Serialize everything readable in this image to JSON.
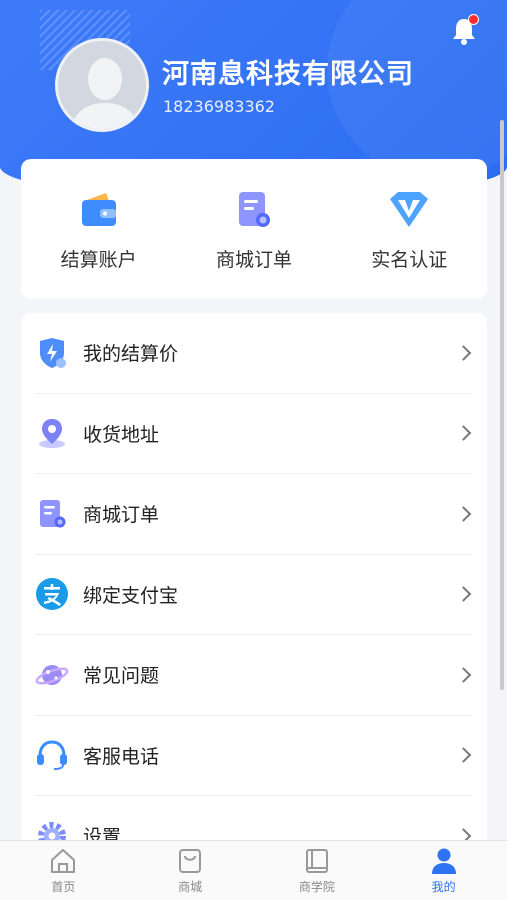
{
  "profile": {
    "company": "河南息科技有限公司",
    "phone": "18236983362"
  },
  "quick_actions": [
    {
      "label": "结算账户",
      "icon": "wallet-icon"
    },
    {
      "label": "商城订单",
      "icon": "order-icon"
    },
    {
      "label": "实名认证",
      "icon": "verify-diamond-icon"
    }
  ],
  "menu": [
    {
      "label": "我的结算价",
      "icon": "settlement-shield-icon"
    },
    {
      "label": "收货地址",
      "icon": "location-pin-icon"
    },
    {
      "label": "商城订单",
      "icon": "order-icon"
    },
    {
      "label": "绑定支付宝",
      "icon": "alipay-icon"
    },
    {
      "label": "常见问题",
      "icon": "planet-icon"
    },
    {
      "label": "客服电话",
      "icon": "headset-icon"
    },
    {
      "label": "设置",
      "icon": "gear-icon"
    }
  ],
  "tabs": [
    {
      "label": "首页",
      "icon": "home-icon"
    },
    {
      "label": "商城",
      "icon": "shopping-bag-icon"
    },
    {
      "label": "商学院",
      "icon": "book-icon"
    },
    {
      "label": "我的",
      "icon": "user-icon",
      "active": true
    }
  ],
  "colors": {
    "brand": "#2f73f5",
    "notification": "#ff2d2d"
  }
}
